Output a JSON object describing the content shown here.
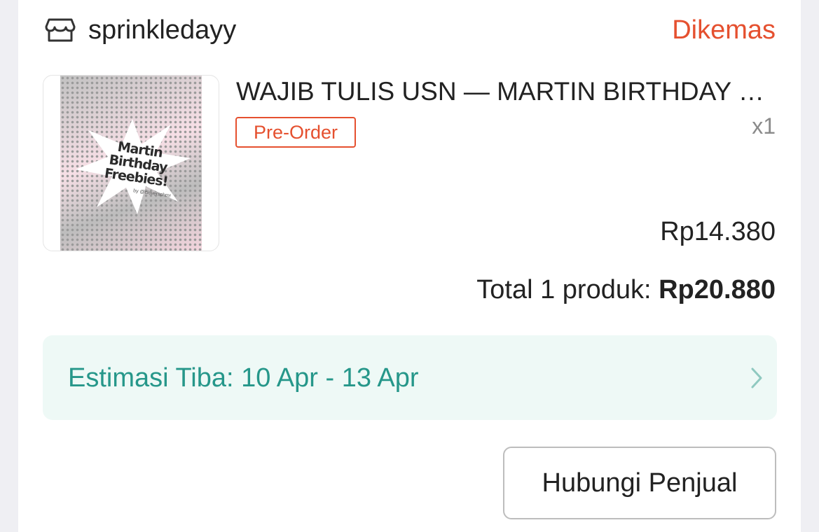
{
  "shop": {
    "icon": "store-icon",
    "name": "sprinkledayy",
    "status": "Dikemas"
  },
  "product": {
    "thumbnail": {
      "line1": "Martin",
      "line2": "Birthday",
      "line3": "Freebies!",
      "credit": "by @cloverschmr"
    },
    "title": "WAJIB TULIS USN — MARTIN BIRTHDAY FREEBIES",
    "badge": "Pre-Order",
    "quantity": "x1",
    "price": "Rp14.380"
  },
  "summary": {
    "label": "Total 1 produk: ",
    "value": "Rp20.880"
  },
  "delivery": {
    "estimate": "Estimasi Tiba: 10 Apr - 13 Apr",
    "icon": "chevron-right-icon"
  },
  "actions": {
    "contact_label": "Hubungi Penjual"
  },
  "colors": {
    "status": "#e5502f",
    "eta_text": "#26978a",
    "eta_bg": "#eef9f6"
  }
}
